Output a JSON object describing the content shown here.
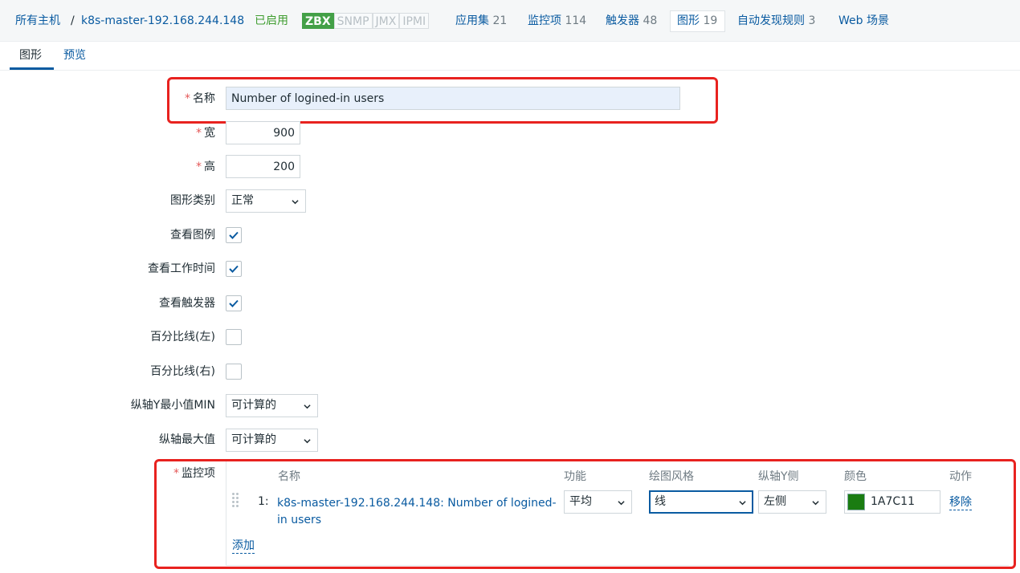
{
  "nav": {
    "all_hosts": "所有主机",
    "separator": "/",
    "host": "k8s-master-192.168.244.148",
    "status": "已启用",
    "badges": [
      "ZBX",
      "SNMP",
      "JMX",
      "IPMI"
    ],
    "applications": "应用集",
    "applications_count": "21",
    "items": "监控项",
    "items_count": "114",
    "triggers": "触发器",
    "triggers_count": "48",
    "graphs": "图形",
    "graphs_count": "19",
    "discovery": "自动发现规则",
    "discovery_count": "3",
    "web": "Web 场景"
  },
  "tabs": {
    "graph": "图形",
    "preview": "预览"
  },
  "form": {
    "required_mark": "*",
    "name_label": "名称",
    "name_value": "Number of logined-in users",
    "width_label": "宽",
    "width_value": "900",
    "height_label": "高",
    "height_value": "200",
    "graph_type_label": "图形类别",
    "graph_type_value": "正常",
    "show_legend_label": "查看图例",
    "show_legend": true,
    "show_working_time_label": "查看工作时间",
    "show_working_time": true,
    "show_triggers_label": "查看触发器",
    "show_triggers": true,
    "percentile_left_label": "百分比线(左)",
    "percentile_left": false,
    "percentile_right_label": "百分比线(右)",
    "percentile_right": false,
    "ymin_label": "纵轴Y最小值MIN",
    "ymin_value": "可计算的",
    "ymax_label": "纵轴最大值",
    "ymax_value": "可计算的",
    "items_label": "监控项"
  },
  "items_table": {
    "headers": {
      "name": "名称",
      "function": "功能",
      "draw_style": "绘图风格",
      "y_axis_side": "纵轴Y侧",
      "color": "颜色",
      "action": "动作"
    },
    "rows": [
      {
        "index": "1:",
        "name": "k8s-master-192.168.244.148: Number of logined-in users",
        "function": "平均",
        "draw_style": "线",
        "y_axis_side": "左侧",
        "color": "1A7C11",
        "remove": "移除"
      }
    ],
    "add": "添加"
  },
  "colors": {
    "link": "#0a5ba1",
    "enabled": "#3f9d30",
    "zbx_badge": "#43a047",
    "highlight_border": "#e8221f",
    "item_color": "#1A7C11"
  }
}
